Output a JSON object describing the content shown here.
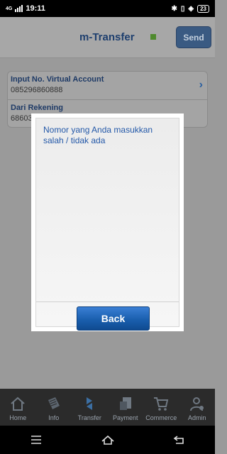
{
  "status_bar": {
    "time": "19:11",
    "network": "4G",
    "battery": "23"
  },
  "header": {
    "title": "m-Transfer",
    "send_label": "Send"
  },
  "form": {
    "field1": {
      "label": "Input No. Virtual Account",
      "value": "085296860888"
    },
    "field2": {
      "label": "Dari Rekening",
      "value": "68603"
    }
  },
  "dialog": {
    "message": "Nomor yang Anda masukkan salah / tidak ada",
    "back_label": "Back"
  },
  "bottom_nav": {
    "items": [
      {
        "label": "Home",
        "icon": "home-icon"
      },
      {
        "label": "Info",
        "icon": "info-icon"
      },
      {
        "label": "Transfer",
        "icon": "transfer-icon"
      },
      {
        "label": "Payment",
        "icon": "payment-icon"
      },
      {
        "label": "Commerce",
        "icon": "cart-icon"
      },
      {
        "label": "Admin",
        "icon": "admin-icon"
      }
    ]
  }
}
